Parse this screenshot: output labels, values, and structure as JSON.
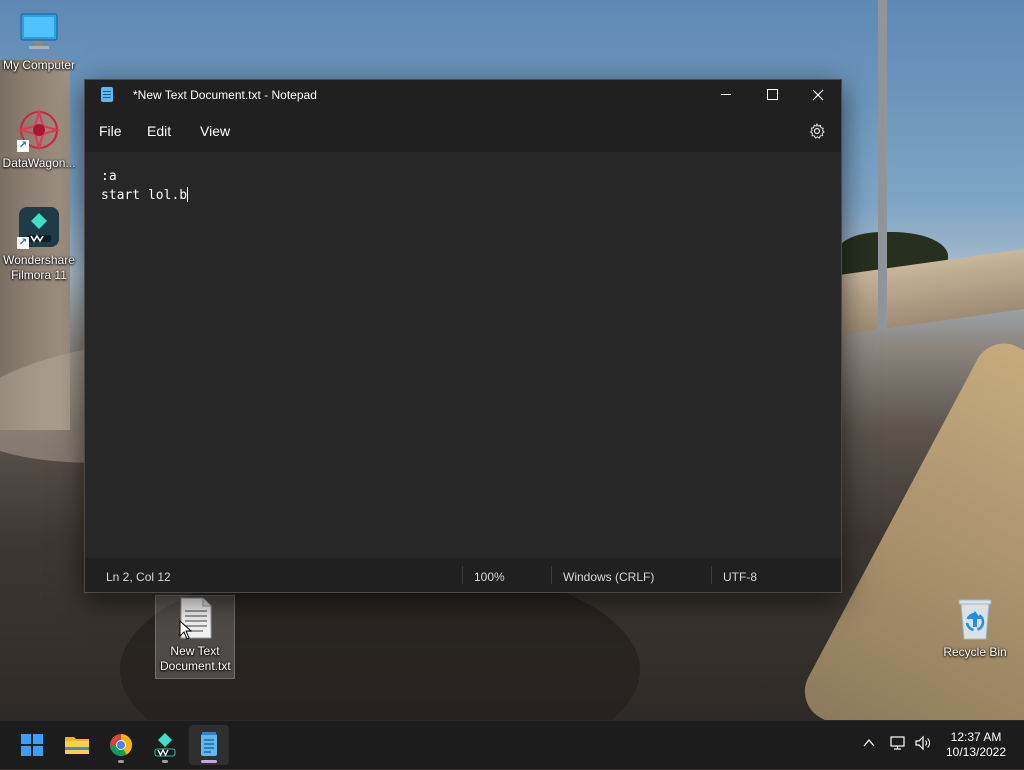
{
  "desktop": {
    "icons": [
      {
        "label": "My Computer",
        "icon": "monitor-icon"
      },
      {
        "label": "DataWagon...",
        "icon": "datawagon-icon"
      },
      {
        "label": "Wondershare Filmora 11",
        "icon": "filmora-icon"
      },
      {
        "label": "New Text Document.txt",
        "icon": "text-file-icon"
      },
      {
        "label": "Recycle Bin",
        "icon": "recycle-bin-icon"
      }
    ]
  },
  "notepad": {
    "title": "*New Text Document.txt - Notepad",
    "menu": [
      "File",
      "Edit",
      "View"
    ],
    "content_lines": [
      ":a",
      "start lol.b"
    ],
    "status": {
      "position": "Ln 2, Col 12",
      "zoom": "100%",
      "line_ending": "Windows (CRLF)",
      "encoding": "UTF-8"
    }
  },
  "taskbar": {
    "apps": [
      "start-icon",
      "file-explorer-icon",
      "chrome-icon",
      "filmora-icon",
      "notepad-icon"
    ],
    "active_app": "notepad-icon",
    "clock": {
      "time": "12:37 AM",
      "date": "10/13/2022"
    }
  },
  "colors": {
    "window_bg": "#272727",
    "titlebar_bg": "#202020",
    "taskbar_bg": "#1c1c1c",
    "accent": "#0078d4"
  }
}
